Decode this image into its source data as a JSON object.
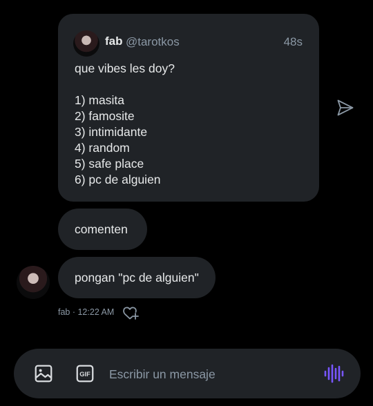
{
  "colors": {
    "background": "#000000",
    "bubble": "#202327",
    "text_primary": "#e7e9ea",
    "text_secondary": "#8b98a5",
    "accent_voice": "#7856ff"
  },
  "quoted_post": {
    "author_name": "fab",
    "author_handle": "@tarotkos",
    "time": "48s",
    "text": "que vibes les doy?\n\n1) masita\n2) famosite\n3) intimidante\n4) random\n5) safe place\n6) pc de alguien"
  },
  "messages": [
    {
      "text": "comenten"
    },
    {
      "text": "pongan \"pc de alguien\""
    }
  ],
  "message_meta": "fab · 12:22 AM",
  "composer": {
    "placeholder": "Escribir un mensaje",
    "gif_label": "GIF"
  },
  "icons": [
    "send-icon",
    "image-icon",
    "gif-icon",
    "voice-message-icon",
    "add-reaction-icon"
  ]
}
